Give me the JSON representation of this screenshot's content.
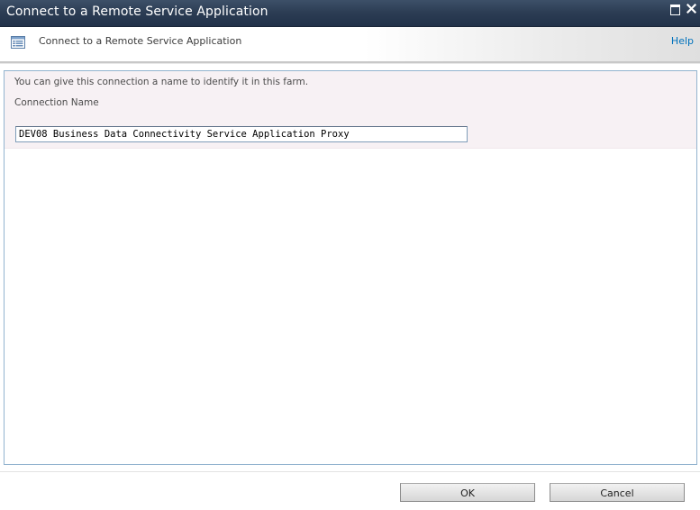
{
  "window": {
    "title": "Connect to a Remote Service Application",
    "maximize_icon": "maximize-icon",
    "close_icon": "close-icon"
  },
  "header": {
    "icon": "page-list-icon",
    "title": "Connect to a Remote Service Application",
    "help_label": "Help",
    "accent_color": "#0072bc"
  },
  "form": {
    "description": "You can give this connection a name to identify it in this farm.",
    "connection_name_label": "Connection Name",
    "connection_name_value": "DEV08 Business Data Connectivity Service Application Proxy"
  },
  "footer": {
    "ok_label": "OK",
    "cancel_label": "Cancel"
  }
}
